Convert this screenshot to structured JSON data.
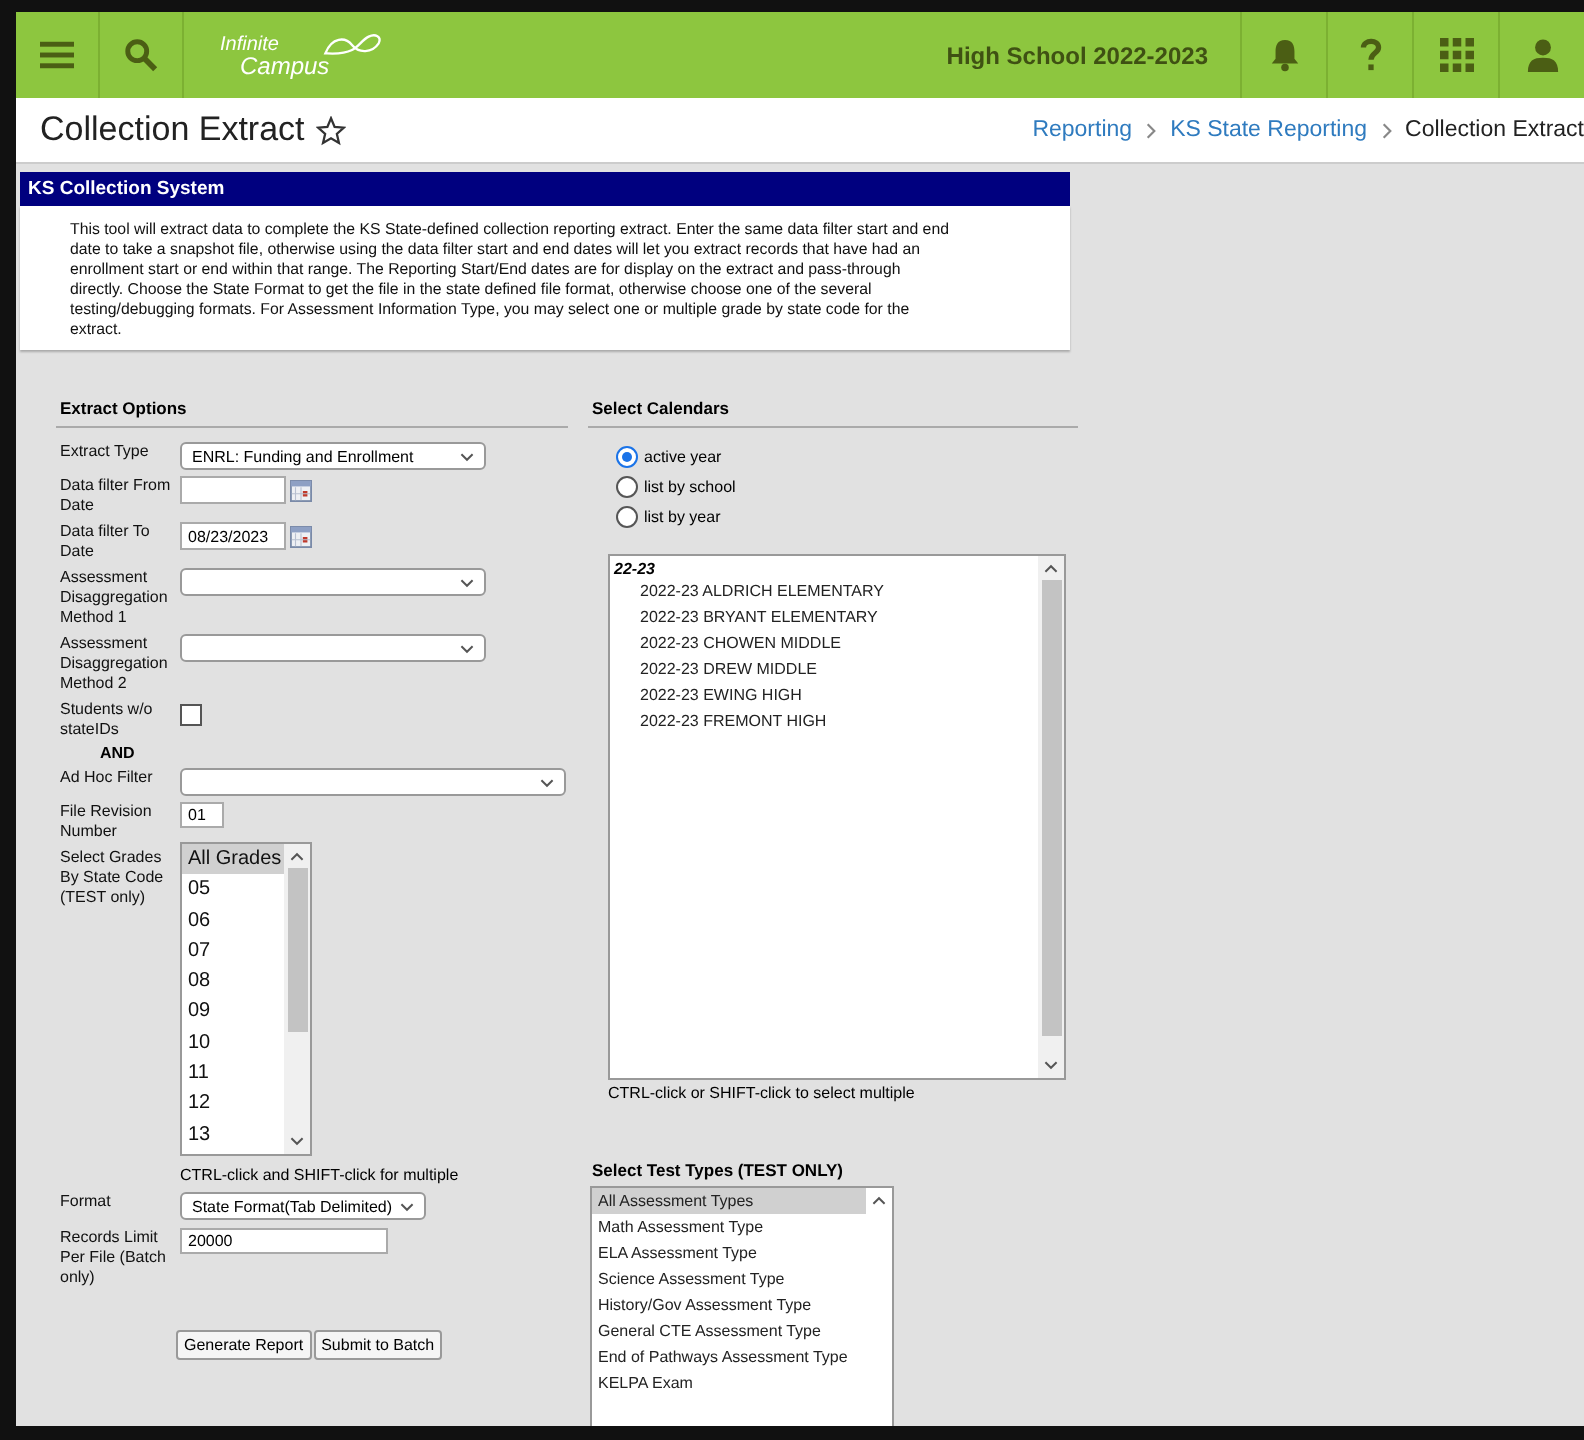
{
  "app_bar": {
    "logo": {
      "line_1": "Infinite",
      "line_2": "Campus"
    },
    "context": "High School 2022-2023"
  },
  "page": {
    "title": "Collection Extract",
    "breadcrumbs": [
      "Reporting",
      "KS State Reporting",
      "Collection Extract"
    ]
  },
  "panel": {
    "title": "KS Collection System",
    "description": "This tool will extract data to complete the KS State-defined collection reporting extract. Enter the same data filter start and end date to take a snapshot file, otherwise using the data filter start and end dates will let you extract records that have had an enrollment start or end within that range. The Reporting Start/End dates are for display on the extract and pass-through directly. Choose the State Format to get the file in the state defined file format, otherwise choose one of the several testing/debugging formats. For Assessment Information Type, you may select one or multiple grade by state code for the extract."
  },
  "extract_options": {
    "title": "Extract Options",
    "fields": [
      {
        "kind": "select",
        "label": "Extract Type",
        "value": "ENRL: Funding and Enrollment"
      },
      {
        "kind": "date",
        "label": "Data filter From Date"
      },
      {
        "kind": "date",
        "label": "Data filter To Date",
        "value": "08/23/2023"
      },
      {
        "kind": "select",
        "label": "Assessment Disaggregation Method 1"
      },
      {
        "kind": "select",
        "label": "Assessment Disaggregation Method 2"
      },
      {
        "kind": "checkbox",
        "label": "Students w/o stateIDs",
        "checked": false
      },
      {
        "kind": "note",
        "label": "AND"
      },
      {
        "kind": "select",
        "label": "Ad Hoc Filter"
      },
      {
        "kind": "text",
        "label": "File Revision Number",
        "value": "01"
      },
      {
        "kind": "listbox",
        "label": "Select Grades By State Code (TEST only)",
        "items": [
          {
            "label": "All Grades",
            "selected": true
          },
          {
            "label": "05",
            "selected": false
          },
          {
            "label": "06",
            "selected": false
          },
          {
            "label": "07",
            "selected": false
          },
          {
            "label": "08",
            "selected": false
          },
          {
            "label": "09",
            "selected": false
          },
          {
            "label": "10",
            "selected": false
          },
          {
            "label": "11",
            "selected": false
          },
          {
            "label": "12",
            "selected": false
          },
          {
            "label": "13",
            "selected": false
          }
        ],
        "hint": "CTRL-click and SHIFT-click for multiple"
      },
      {
        "kind": "select",
        "label": "Format",
        "value": "State Format(Tab Delimited)"
      },
      {
        "kind": "text",
        "label": "Records Limit Per File (Batch only)",
        "value": "20000"
      }
    ],
    "buttons": [
      "Generate Report",
      "Submit to Batch"
    ]
  },
  "calendars": {
    "title": "Select Calendars",
    "options": [
      {
        "label": "active year",
        "selected": true
      },
      {
        "label": "list by school",
        "selected": false
      },
      {
        "label": "list by year",
        "selected": false
      }
    ],
    "group": "22-23",
    "items": [
      {
        "label": "2022-23 ALDRICH ELEMENTARY",
        "selected": false
      },
      {
        "label": "2022-23 BRYANT ELEMENTARY",
        "selected": false
      },
      {
        "label": "2022-23 CHOWEN MIDDLE",
        "selected": false
      },
      {
        "label": "2022-23 DREW MIDDLE",
        "selected": false
      },
      {
        "label": "2022-23 EWING HIGH",
        "selected": false
      },
      {
        "label": "2022-23 FREMONT HIGH",
        "selected": false
      }
    ],
    "hint": "CTRL-click or SHIFT-click to select multiple"
  },
  "test_types": {
    "title": "Select Test Types (TEST ONLY)",
    "items": [
      {
        "label": "All Assessment Types",
        "selected": true
      },
      {
        "label": "Math Assessment Type",
        "selected": false
      },
      {
        "label": "ELA Assessment Type",
        "selected": false
      },
      {
        "label": "Science Assessment Type",
        "selected": false
      },
      {
        "label": "History/Gov Assessment Type",
        "selected": false
      },
      {
        "label": "General CTE Assessment Type",
        "selected": false
      },
      {
        "label": "End of Pathways Assessment Type",
        "selected": false
      },
      {
        "label": "KELPA Exam",
        "selected": false
      }
    ]
  }
}
